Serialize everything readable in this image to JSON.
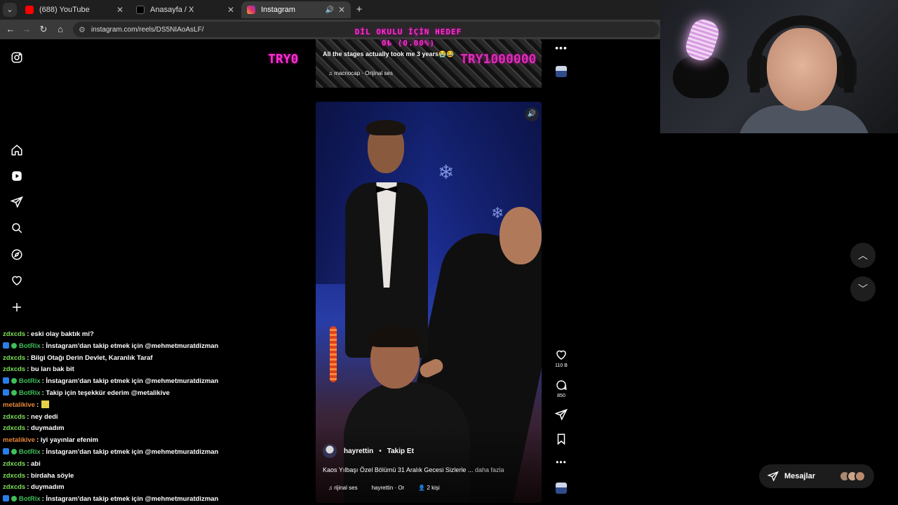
{
  "browser": {
    "tabs": [
      {
        "title": "(688) YouTube",
        "color": "#ff0000",
        "active": false
      },
      {
        "title": "Anasayfa / X",
        "color": "#000000",
        "active": false
      },
      {
        "title": "Instagram",
        "color": "#e1306c",
        "active": true
      }
    ],
    "url": "instagram.com/reels/DS5NIAoAsLF/"
  },
  "overlay": {
    "goal_line1": "DİL OKULU İÇİN HEDEF",
    "goal_line2": "0₺ (0.00%)",
    "goal_left": "TRY0",
    "goal_right": "TRY1000000"
  },
  "previous_reel": {
    "caption": "All the stages actually took me 3 years😭😂",
    "audio": "macnocap · Orijinal ses"
  },
  "reel": {
    "username": "hayrettin",
    "follow": "Takip Et",
    "description": "Kaos Yılbaşı Özel Bölümü 31 Aralık Gecesi Sizlerle ...",
    "more": "daha fazla",
    "audio": "rijinal ses",
    "audio_owner": "hayrettin · Or",
    "people": "2 kişi"
  },
  "actions": {
    "likes": "110 B",
    "comments": "850"
  },
  "messages": {
    "label": "Mesajlar"
  },
  "chat": [
    {
      "user": "zdxcds",
      "color": "#7ee05a",
      "text": ": eski olay baktık mi?",
      "badge": false
    },
    {
      "user": "BotRix",
      "color": "#3fbf5a",
      "text": ": İnstagram'dan takip etmek için @mehmetmuratdizman",
      "badge": true
    },
    {
      "user": "zdxcds",
      "color": "#7ee05a",
      "text": ": Bilgi Otağı Derin Devlet, Karanlık Taraf",
      "badge": false
    },
    {
      "user": "zdxcds",
      "color": "#7ee05a",
      "text": ": bu ları bak bit",
      "badge": false
    },
    {
      "user": "BotRix",
      "color": "#3fbf5a",
      "text": ": İnstagram'dan takip etmek için @mehmetmuratdizman",
      "badge": true
    },
    {
      "user": "BotRix",
      "color": "#3fbf5a",
      "text": ": Takip için teşekkür ederim @metalikive",
      "badge": true
    },
    {
      "user": "metalikive",
      "color": "#e8873a",
      "text": ":",
      "badge": false,
      "emote": true
    },
    {
      "user": "zdxcds",
      "color": "#7ee05a",
      "text": ": ney dedi",
      "badge": false
    },
    {
      "user": "zdxcds",
      "color": "#7ee05a",
      "text": ": duymadım",
      "badge": false
    },
    {
      "user": "metalikive",
      "color": "#e8873a",
      "text": ": iyi yayınlar efenim",
      "badge": false
    },
    {
      "user": "BotRix",
      "color": "#3fbf5a",
      "text": ": İnstagram'dan takip etmek için @mehmetmuratdizman",
      "badge": true
    },
    {
      "user": "zdxcds",
      "color": "#7ee05a",
      "text": ": abi",
      "badge": false
    },
    {
      "user": "zdxcds",
      "color": "#7ee05a",
      "text": ": birdaha söyle",
      "badge": false
    },
    {
      "user": "zdxcds",
      "color": "#7ee05a",
      "text": ": duymadım",
      "badge": false
    },
    {
      "user": "BotRix",
      "color": "#3fbf5a",
      "text": ": İnstagram'dan takip etmek için @mehmetmuratdizman",
      "badge": true
    }
  ]
}
